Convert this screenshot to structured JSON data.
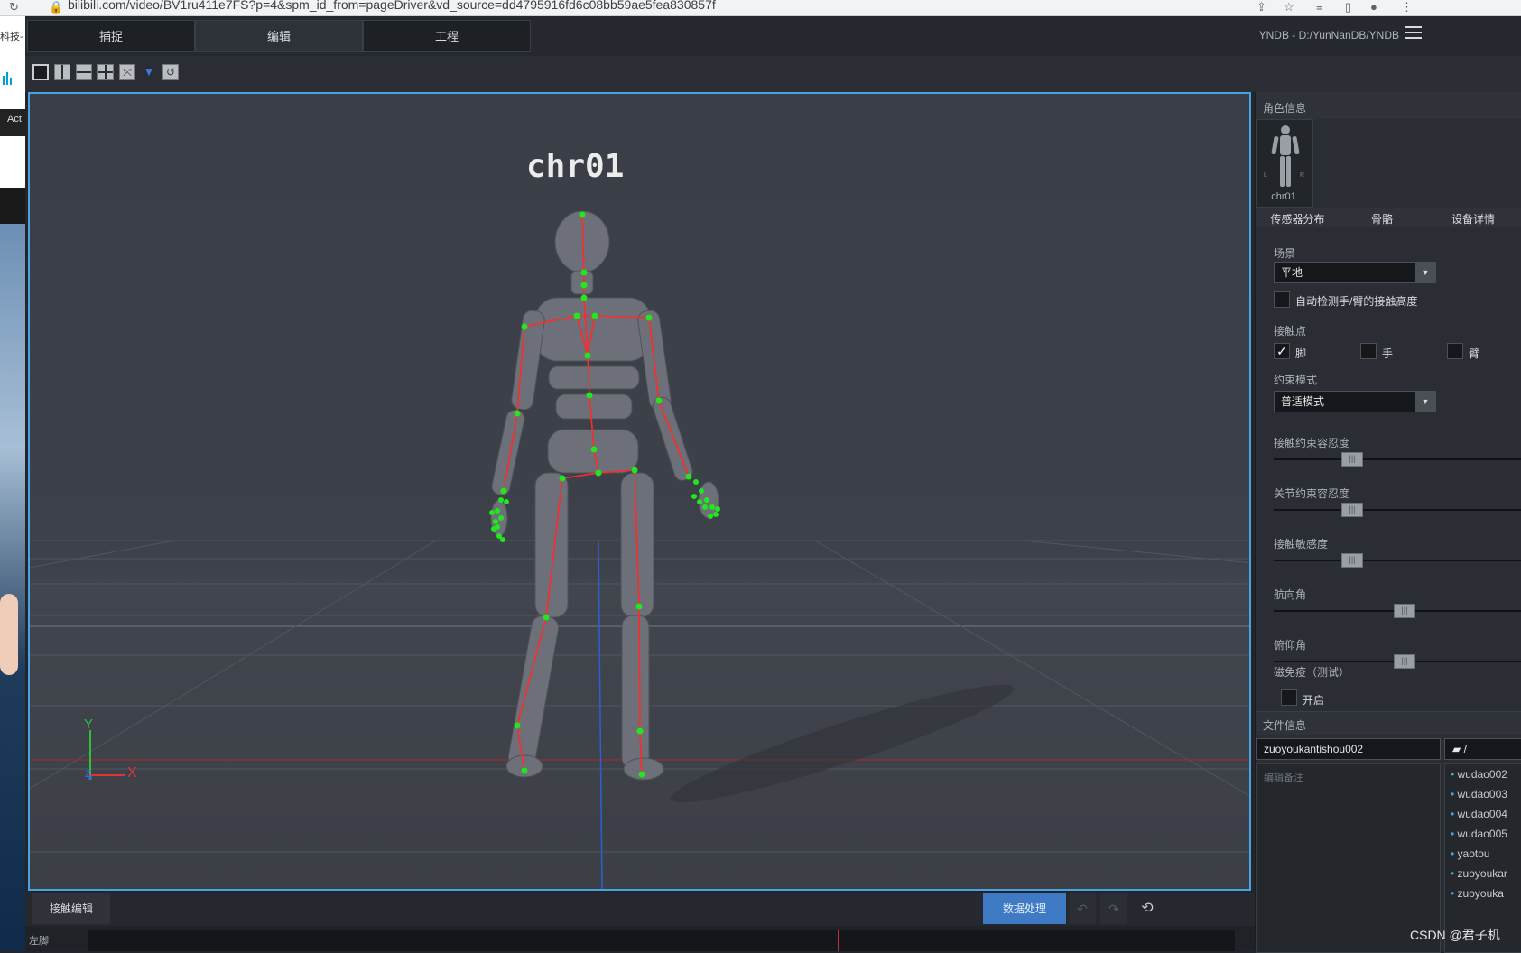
{
  "browser": {
    "url": "bilibili.com/video/BV1ru411e7FS?p=4&spm_id_from=pageDriver&vd_source=dd4795916fd6c08bb59ae5fea830857f",
    "left_page_text": "科技-",
    "left_page_text2": "Act"
  },
  "app": {
    "tabs": [
      {
        "label": "捕捉"
      },
      {
        "label": "编辑"
      },
      {
        "label": "工程"
      }
    ],
    "project_path": "YNDB - D:/YunNanDB/YNDB"
  },
  "viewport": {
    "character_name": "chr01",
    "axis_x": "X",
    "axis_y": "Y",
    "axis_z": "Z"
  },
  "panel": {
    "role_info_title": "角色信息",
    "avatar_label": "chr01",
    "avatar_left": "L",
    "avatar_right": "R",
    "subtabs": [
      "传感器分布",
      "骨骼",
      "设备详情"
    ],
    "scene_label": "场景",
    "scene_value": "平地",
    "auto_detect_label": "自动检测手/臂的接触高度",
    "contact_label": "接触点",
    "contact_foot": "脚",
    "contact_hand": "手",
    "contact_arm": "臂",
    "constraint_mode_label": "约束模式",
    "constraint_mode_value": "普适模式",
    "sliders": [
      {
        "label": "接触约束容忍度",
        "value": 0.3
      },
      {
        "label": "关节约束容忍度",
        "value": 0.3
      },
      {
        "label": "接触敏感度",
        "value": 0.3
      },
      {
        "label": "航向角",
        "value": 0.5
      },
      {
        "label": "俯仰角",
        "value": 0.5
      }
    ],
    "magnetic_label": "磁免疫（测试）",
    "magnetic_enable": "开启",
    "file_info_title": "文件信息",
    "file_name": "zuoyoukantishou002",
    "folder_label": "/",
    "note_placeholder": "编辑备注",
    "file_list": [
      "wudao002",
      "wudao003",
      "wudao004",
      "wudao005",
      "yaotou",
      "zuoyoukar",
      "zuoyouka"
    ]
  },
  "bottom": {
    "tab_label": "接触编辑",
    "process_button": "数据处理",
    "track_label": "左脚"
  },
  "watermark": "CSDN @君子机",
  "colors": {
    "selection_blue": "#4aa3e0",
    "bone_red": "#ff2a2a",
    "joint_green": "#22e61e",
    "button_blue": "#3f7bc4"
  }
}
